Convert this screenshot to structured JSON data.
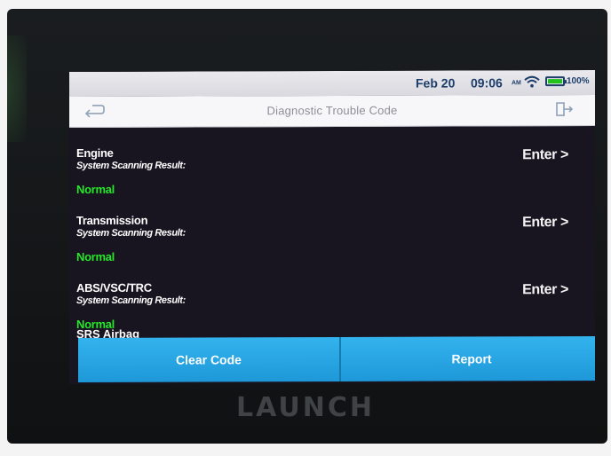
{
  "status_bar": {
    "date": "Feb 20",
    "time": "09:06",
    "ampm": "AM",
    "battery": "100%",
    "wifi_icon": "wifi-icon",
    "battery_icon": "battery-icon"
  },
  "header": {
    "title": "Diagnostic Trouble Code",
    "back_icon": "back-arrow-icon",
    "exit_icon": "exit-icon"
  },
  "systems": [
    {
      "name": "Engine",
      "label": "System Scanning Result:",
      "status": "Normal",
      "enter": "Enter >"
    },
    {
      "name": "Transmission",
      "label": "System Scanning Result:",
      "status": "Normal",
      "enter": "Enter >"
    },
    {
      "name": "ABS/VSC/TRC",
      "label": "System Scanning Result:",
      "status": "Normal",
      "enter": "Enter >"
    }
  ],
  "partial_system": "SRS Airbag",
  "footer": {
    "clear_code": "Clear Code",
    "report": "Report"
  },
  "brand": "LAUNCH",
  "colors": {
    "accent": "#1e98d8",
    "status_ok": "#28e62a",
    "screen_bg": "#181420"
  }
}
